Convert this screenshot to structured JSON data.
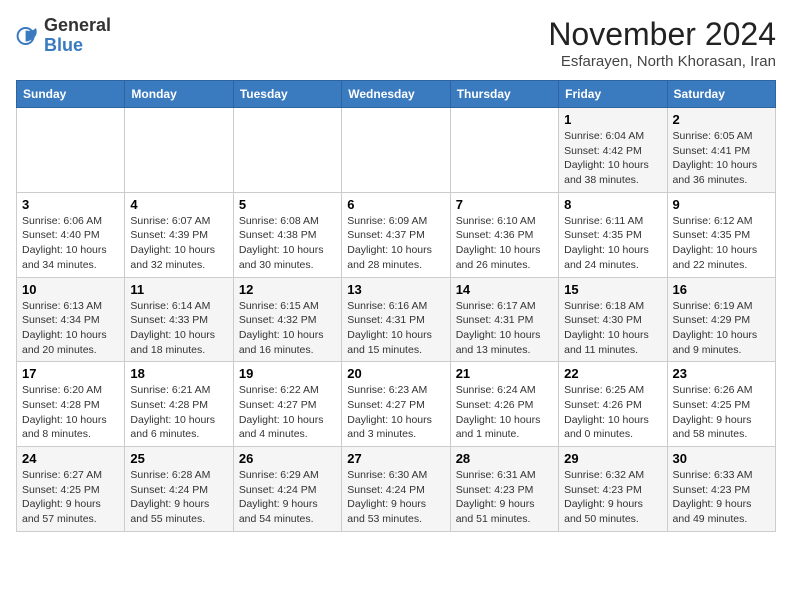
{
  "header": {
    "logo": {
      "general": "General",
      "blue": "Blue"
    },
    "title": "November 2024",
    "location": "Esfarayen, North Khorasan, Iran"
  },
  "weekdays": [
    "Sunday",
    "Monday",
    "Tuesday",
    "Wednesday",
    "Thursday",
    "Friday",
    "Saturday"
  ],
  "weeks": [
    [
      {
        "day": "",
        "info": ""
      },
      {
        "day": "",
        "info": ""
      },
      {
        "day": "",
        "info": ""
      },
      {
        "day": "",
        "info": ""
      },
      {
        "day": "",
        "info": ""
      },
      {
        "day": "1",
        "info": "Sunrise: 6:04 AM\nSunset: 4:42 PM\nDaylight: 10 hours and 38 minutes."
      },
      {
        "day": "2",
        "info": "Sunrise: 6:05 AM\nSunset: 4:41 PM\nDaylight: 10 hours and 36 minutes."
      }
    ],
    [
      {
        "day": "3",
        "info": "Sunrise: 6:06 AM\nSunset: 4:40 PM\nDaylight: 10 hours and 34 minutes."
      },
      {
        "day": "4",
        "info": "Sunrise: 6:07 AM\nSunset: 4:39 PM\nDaylight: 10 hours and 32 minutes."
      },
      {
        "day": "5",
        "info": "Sunrise: 6:08 AM\nSunset: 4:38 PM\nDaylight: 10 hours and 30 minutes."
      },
      {
        "day": "6",
        "info": "Sunrise: 6:09 AM\nSunset: 4:37 PM\nDaylight: 10 hours and 28 minutes."
      },
      {
        "day": "7",
        "info": "Sunrise: 6:10 AM\nSunset: 4:36 PM\nDaylight: 10 hours and 26 minutes."
      },
      {
        "day": "8",
        "info": "Sunrise: 6:11 AM\nSunset: 4:35 PM\nDaylight: 10 hours and 24 minutes."
      },
      {
        "day": "9",
        "info": "Sunrise: 6:12 AM\nSunset: 4:35 PM\nDaylight: 10 hours and 22 minutes."
      }
    ],
    [
      {
        "day": "10",
        "info": "Sunrise: 6:13 AM\nSunset: 4:34 PM\nDaylight: 10 hours and 20 minutes."
      },
      {
        "day": "11",
        "info": "Sunrise: 6:14 AM\nSunset: 4:33 PM\nDaylight: 10 hours and 18 minutes."
      },
      {
        "day": "12",
        "info": "Sunrise: 6:15 AM\nSunset: 4:32 PM\nDaylight: 10 hours and 16 minutes."
      },
      {
        "day": "13",
        "info": "Sunrise: 6:16 AM\nSunset: 4:31 PM\nDaylight: 10 hours and 15 minutes."
      },
      {
        "day": "14",
        "info": "Sunrise: 6:17 AM\nSunset: 4:31 PM\nDaylight: 10 hours and 13 minutes."
      },
      {
        "day": "15",
        "info": "Sunrise: 6:18 AM\nSunset: 4:30 PM\nDaylight: 10 hours and 11 minutes."
      },
      {
        "day": "16",
        "info": "Sunrise: 6:19 AM\nSunset: 4:29 PM\nDaylight: 10 hours and 9 minutes."
      }
    ],
    [
      {
        "day": "17",
        "info": "Sunrise: 6:20 AM\nSunset: 4:28 PM\nDaylight: 10 hours and 8 minutes."
      },
      {
        "day": "18",
        "info": "Sunrise: 6:21 AM\nSunset: 4:28 PM\nDaylight: 10 hours and 6 minutes."
      },
      {
        "day": "19",
        "info": "Sunrise: 6:22 AM\nSunset: 4:27 PM\nDaylight: 10 hours and 4 minutes."
      },
      {
        "day": "20",
        "info": "Sunrise: 6:23 AM\nSunset: 4:27 PM\nDaylight: 10 hours and 3 minutes."
      },
      {
        "day": "21",
        "info": "Sunrise: 6:24 AM\nSunset: 4:26 PM\nDaylight: 10 hours and 1 minute."
      },
      {
        "day": "22",
        "info": "Sunrise: 6:25 AM\nSunset: 4:26 PM\nDaylight: 10 hours and 0 minutes."
      },
      {
        "day": "23",
        "info": "Sunrise: 6:26 AM\nSunset: 4:25 PM\nDaylight: 9 hours and 58 minutes."
      }
    ],
    [
      {
        "day": "24",
        "info": "Sunrise: 6:27 AM\nSunset: 4:25 PM\nDaylight: 9 hours and 57 minutes."
      },
      {
        "day": "25",
        "info": "Sunrise: 6:28 AM\nSunset: 4:24 PM\nDaylight: 9 hours and 55 minutes."
      },
      {
        "day": "26",
        "info": "Sunrise: 6:29 AM\nSunset: 4:24 PM\nDaylight: 9 hours and 54 minutes."
      },
      {
        "day": "27",
        "info": "Sunrise: 6:30 AM\nSunset: 4:24 PM\nDaylight: 9 hours and 53 minutes."
      },
      {
        "day": "28",
        "info": "Sunrise: 6:31 AM\nSunset: 4:23 PM\nDaylight: 9 hours and 51 minutes."
      },
      {
        "day": "29",
        "info": "Sunrise: 6:32 AM\nSunset: 4:23 PM\nDaylight: 9 hours and 50 minutes."
      },
      {
        "day": "30",
        "info": "Sunrise: 6:33 AM\nSunset: 4:23 PM\nDaylight: 9 hours and 49 minutes."
      }
    ]
  ]
}
